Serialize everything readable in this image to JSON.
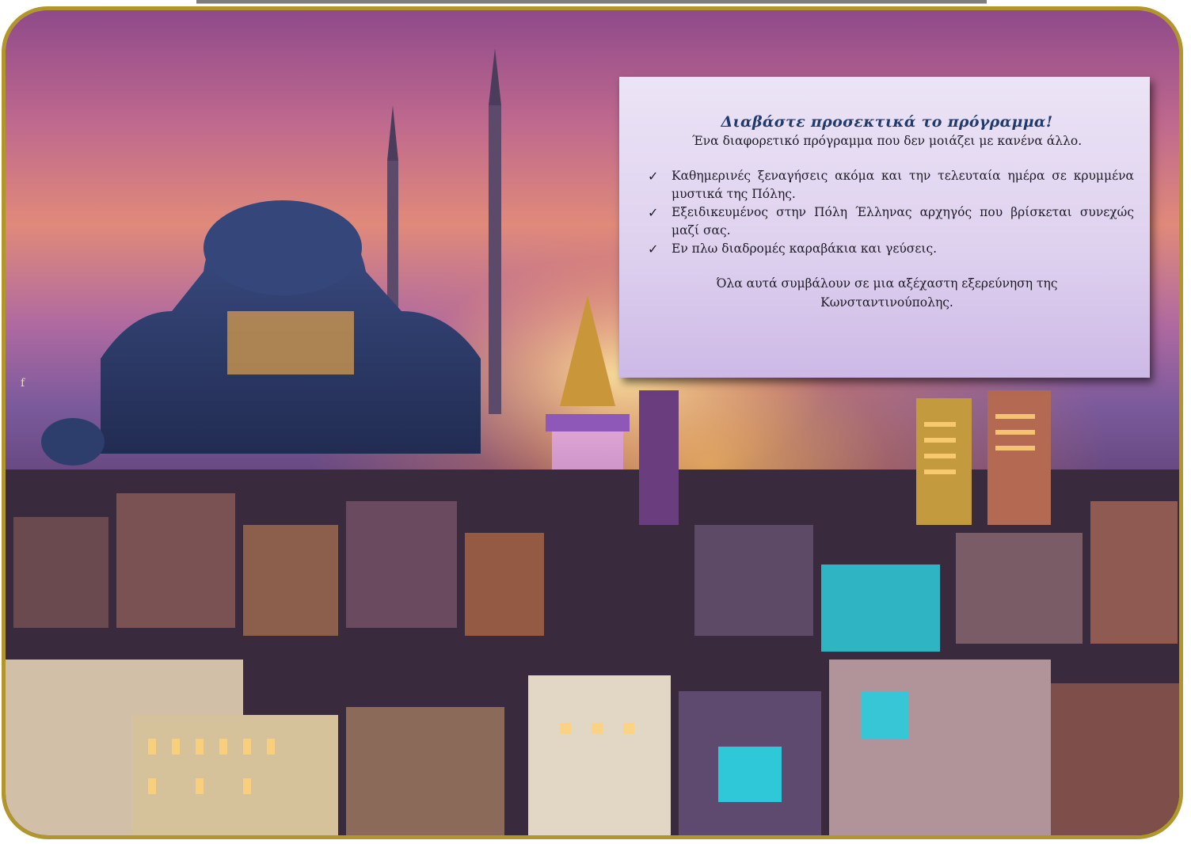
{
  "info_box": {
    "title": "Διαβάστε προσεκτικά το πρόγραμμα!",
    "subtitle": "Ένα διαφορετικό πρόγραμμα που δεν μοιάζει με κανένα άλλο.",
    "points": [
      "Καθημερινές ξεναγήσεις ακόμα και την τελευταία ημέρα σε κρυμμένα μυστικά της Πόλης.",
      "Εξειδικευμένος στην Πόλη Έλληνας αρχηγός που βρίσκεται συνεχώς μαζί σας.",
      "Εν πλω διαδρομές καραβάκια και γεύσεις."
    ],
    "closing": "Όλα αυτά συμβάλουν σε μια αξέχαστη εξερεύνηση της Κωνσταντινούπολης.",
    "check_icon": "checkmark-icon"
  },
  "side_mark": "f",
  "colors": {
    "frame_border": "#b1962a",
    "title_color": "#1f3a6b",
    "box_background": "#ddd0ee"
  }
}
